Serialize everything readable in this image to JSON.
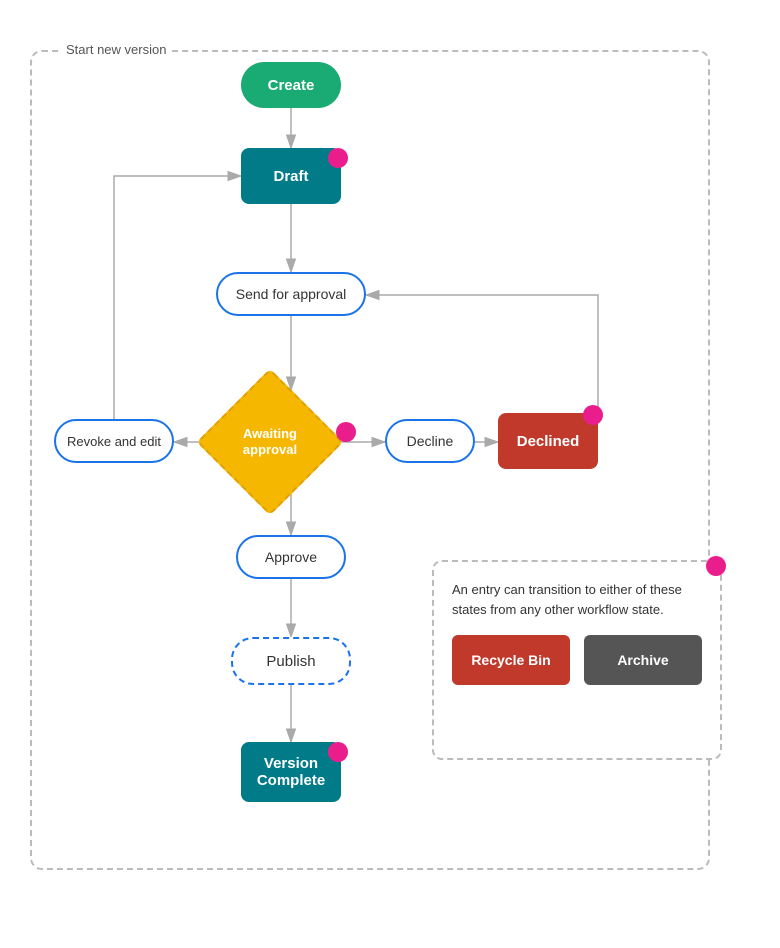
{
  "diagram": {
    "start_label": "Start new version",
    "nodes": {
      "create": {
        "label": "Create"
      },
      "draft": {
        "label": "Draft"
      },
      "send_approval": {
        "label": "Send for approval"
      },
      "awaiting_approval": {
        "label": "Awaiting approval"
      },
      "revoke_edit": {
        "label": "Revoke and edit"
      },
      "decline": {
        "label": "Decline"
      },
      "declined": {
        "label": "Declined"
      },
      "approve": {
        "label": "Approve"
      },
      "publish": {
        "label": "Publish"
      },
      "version_complete": {
        "label": "Version Complete"
      }
    },
    "info_box": {
      "text": "An entry can transition to either of these states from any other workflow state.",
      "recycle_bin": "Recycle Bin",
      "archive": "Archive"
    }
  }
}
